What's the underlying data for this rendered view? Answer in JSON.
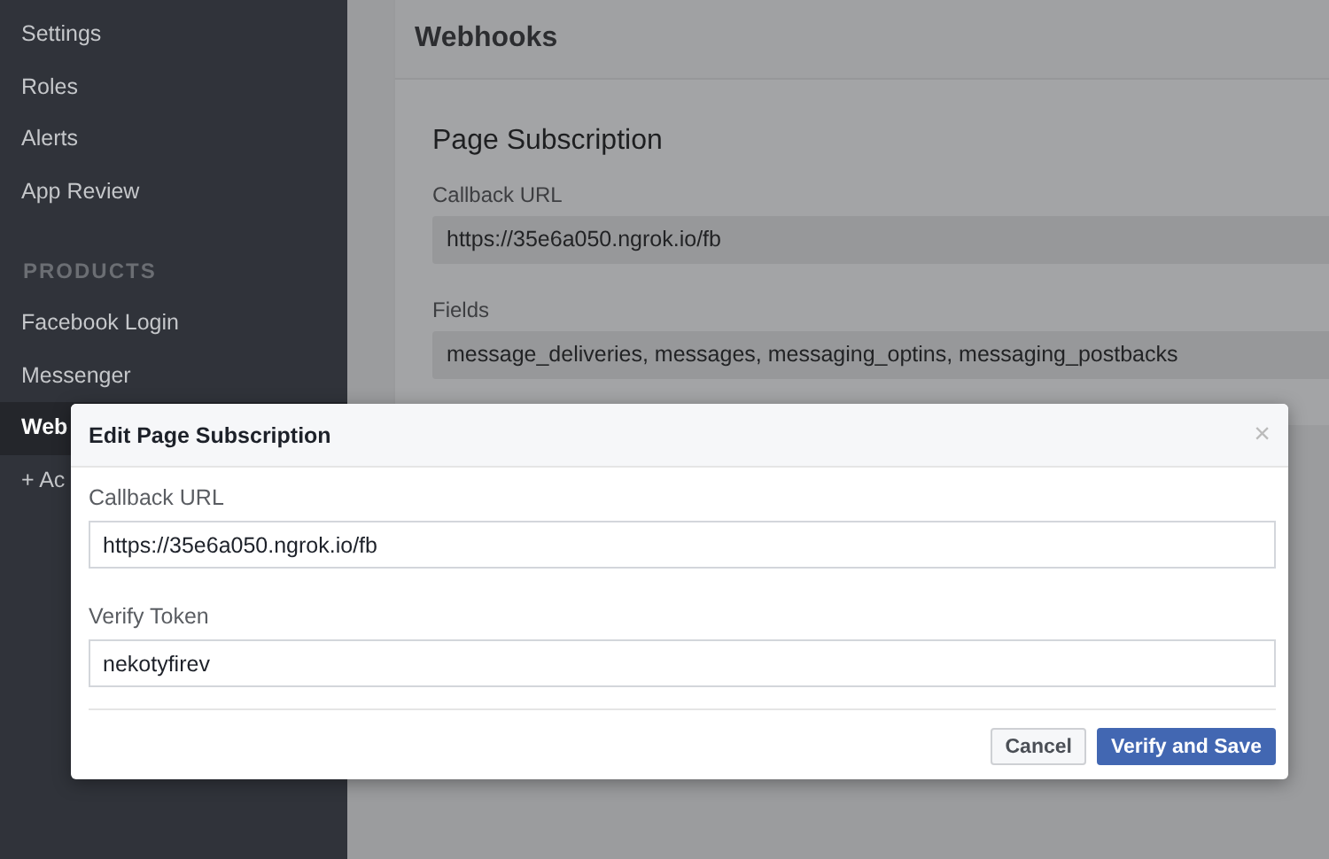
{
  "sidebar": {
    "items": [
      {
        "kind": "link",
        "label": "Settings",
        "selected": false
      },
      {
        "kind": "link",
        "label": "Roles",
        "selected": false
      },
      {
        "kind": "link",
        "label": "Alerts",
        "selected": false
      },
      {
        "kind": "link",
        "label": "App Review",
        "selected": false
      },
      {
        "kind": "heading",
        "label": "PRODUCTS"
      },
      {
        "kind": "link",
        "label": "Facebook Login",
        "selected": false
      },
      {
        "kind": "link",
        "label": "Messenger",
        "selected": false
      },
      {
        "kind": "link",
        "label": "Web",
        "selected": true
      },
      {
        "kind": "link",
        "label": "+ Ac",
        "selected": false
      }
    ]
  },
  "card": {
    "title": "Webhooks",
    "section_title": "Page Subscription",
    "fields": [
      {
        "label": "Callback URL",
        "value": "https://35e6a050.ngrok.io/fb"
      },
      {
        "label": "Fields",
        "value": "message_deliveries, messages, messaging_optins, messaging_postbacks"
      }
    ]
  },
  "dialog": {
    "title": "Edit Page Subscription",
    "close": "×",
    "fields": [
      {
        "label": "Callback URL",
        "value": "https://35e6a050.ngrok.io/fb"
      },
      {
        "label": "Verify Token",
        "value": "nekotyfirev"
      }
    ],
    "buttons": [
      {
        "label": "Cancel",
        "kind": "secondary"
      },
      {
        "label": "Verify and Save",
        "kind": "primary"
      }
    ]
  }
}
